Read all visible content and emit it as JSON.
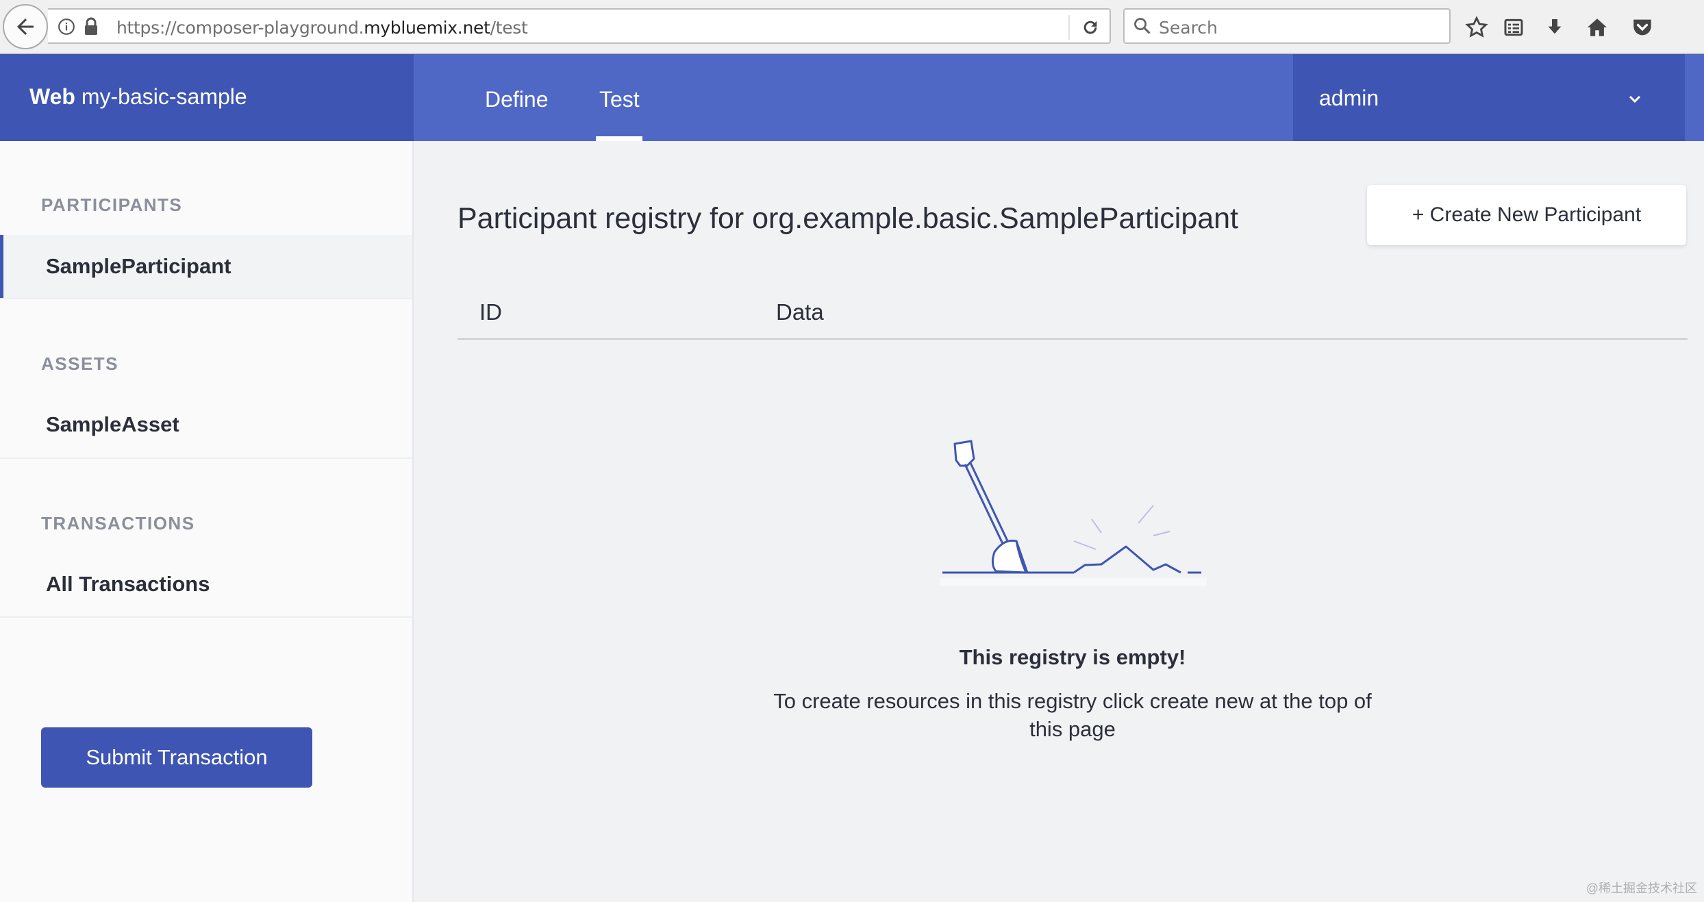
{
  "browser": {
    "url_prefix": "https://composer-playground.",
    "url_host": "mybluemix.net",
    "url_path": "/test",
    "search_placeholder": "Search"
  },
  "header": {
    "brand_bold": "Web",
    "brand_name": "my-basic-sample",
    "tabs": [
      {
        "label": "Define",
        "active": false
      },
      {
        "label": "Test",
        "active": true
      }
    ],
    "user": "admin"
  },
  "sidebar": {
    "sections": [
      {
        "label": "PARTICIPANTS",
        "items": [
          {
            "label": "SampleParticipant",
            "active": true
          }
        ]
      },
      {
        "label": "ASSETS",
        "items": [
          {
            "label": "SampleAsset",
            "active": false
          }
        ]
      },
      {
        "label": "TRANSACTIONS",
        "items": [
          {
            "label": "All Transactions",
            "active": false
          }
        ]
      }
    ],
    "submit_label": "Submit Transaction"
  },
  "main": {
    "title": "Participant registry for org.example.basic.SampleParticipant",
    "create_button": "+ Create New Participant",
    "columns": [
      "ID",
      "Data"
    ],
    "empty_title": "This registry is empty!",
    "empty_text": "To create resources in this registry click create new at the top of this page"
  },
  "watermark": "@稀土掘金技术社区",
  "colors": {
    "header": "#5068c5",
    "header_dark": "#3e55b3",
    "primary": "#3e55b3"
  }
}
